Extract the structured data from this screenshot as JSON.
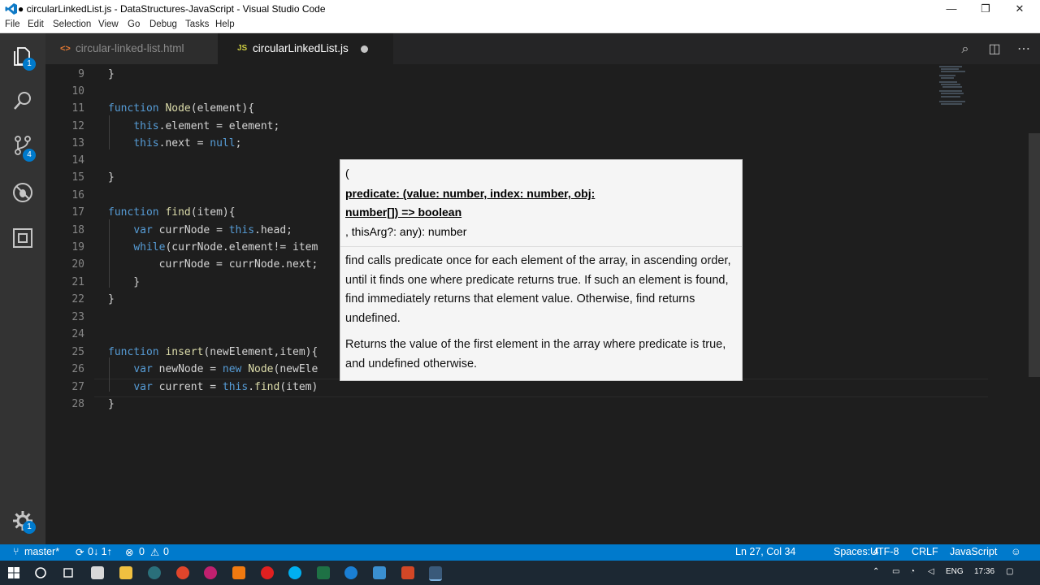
{
  "window": {
    "title": "● circularLinkedList.js - DataStructures-JavaScript - Visual Studio Code",
    "minimize": "—",
    "restore": "❐",
    "close": "✕"
  },
  "menu": [
    "File",
    "Edit",
    "Selection",
    "View",
    "Go",
    "Debug",
    "Tasks",
    "Help"
  ],
  "activity": {
    "explorer_badge": "1",
    "scm_badge": "4",
    "settings_badge": "1"
  },
  "tabs": [
    {
      "icon": "<>",
      "label": "circular-linked-list.html"
    },
    {
      "icon": "JS",
      "label": "circularLinkedList.js"
    }
  ],
  "editor": {
    "lines": [
      {
        "n": "9",
        "text": "}"
      },
      {
        "n": "10",
        "text": ""
      },
      {
        "n": "11",
        "text": "function Node(element){"
      },
      {
        "n": "12",
        "text": "    this.element = element;"
      },
      {
        "n": "13",
        "text": "    this.next = null;"
      },
      {
        "n": "14",
        "text": ""
      },
      {
        "n": "15",
        "text": "}"
      },
      {
        "n": "16",
        "text": ""
      },
      {
        "n": "17",
        "text": "function find(item){"
      },
      {
        "n": "18",
        "text": "    var currNode = this.head;"
      },
      {
        "n": "19",
        "text": "    while(currNode.element!= item"
      },
      {
        "n": "20",
        "text": "        currNode = currNode.next;"
      },
      {
        "n": "21",
        "text": "    }"
      },
      {
        "n": "22",
        "text": "}"
      },
      {
        "n": "23",
        "text": ""
      },
      {
        "n": "24",
        "text": ""
      },
      {
        "n": "25",
        "text": "function insert(newElement,item){"
      },
      {
        "n": "26",
        "text": "    var newNode = new Node(newEle"
      },
      {
        "n": "27",
        "text": "    var current = this.find(item)"
      },
      {
        "n": "28",
        "text": "}"
      }
    ]
  },
  "hover": {
    "open_paren": "(",
    "param_line1": "predicate: (value: number, index: number, obj:",
    "param_line2": "number[]) => boolean",
    "rest": ", thisArg?: any): number",
    "doc1": "find calls predicate once for each element of the array, in ascending order, until it finds one where predicate returns true. If such an element is found, find immediately returns that element value. Otherwise, find returns undefined.",
    "doc2": "Returns the value of the first element in the array where predicate is true, and undefined otherwise."
  },
  "status": {
    "branch": "master*",
    "sync": "0↓ 1↑",
    "errors": "0",
    "warnings": "0",
    "position": "Ln 27, Col 34",
    "spaces": "Spaces: 4",
    "encoding": "UTF-8",
    "eol": "CRLF",
    "language": "JavaScript"
  },
  "taskbar": {
    "lang": "ENG",
    "time": "17:36"
  },
  "colors": {
    "accent": "#007acc",
    "keyword": "#569cd6",
    "function": "#dcdcaa"
  }
}
